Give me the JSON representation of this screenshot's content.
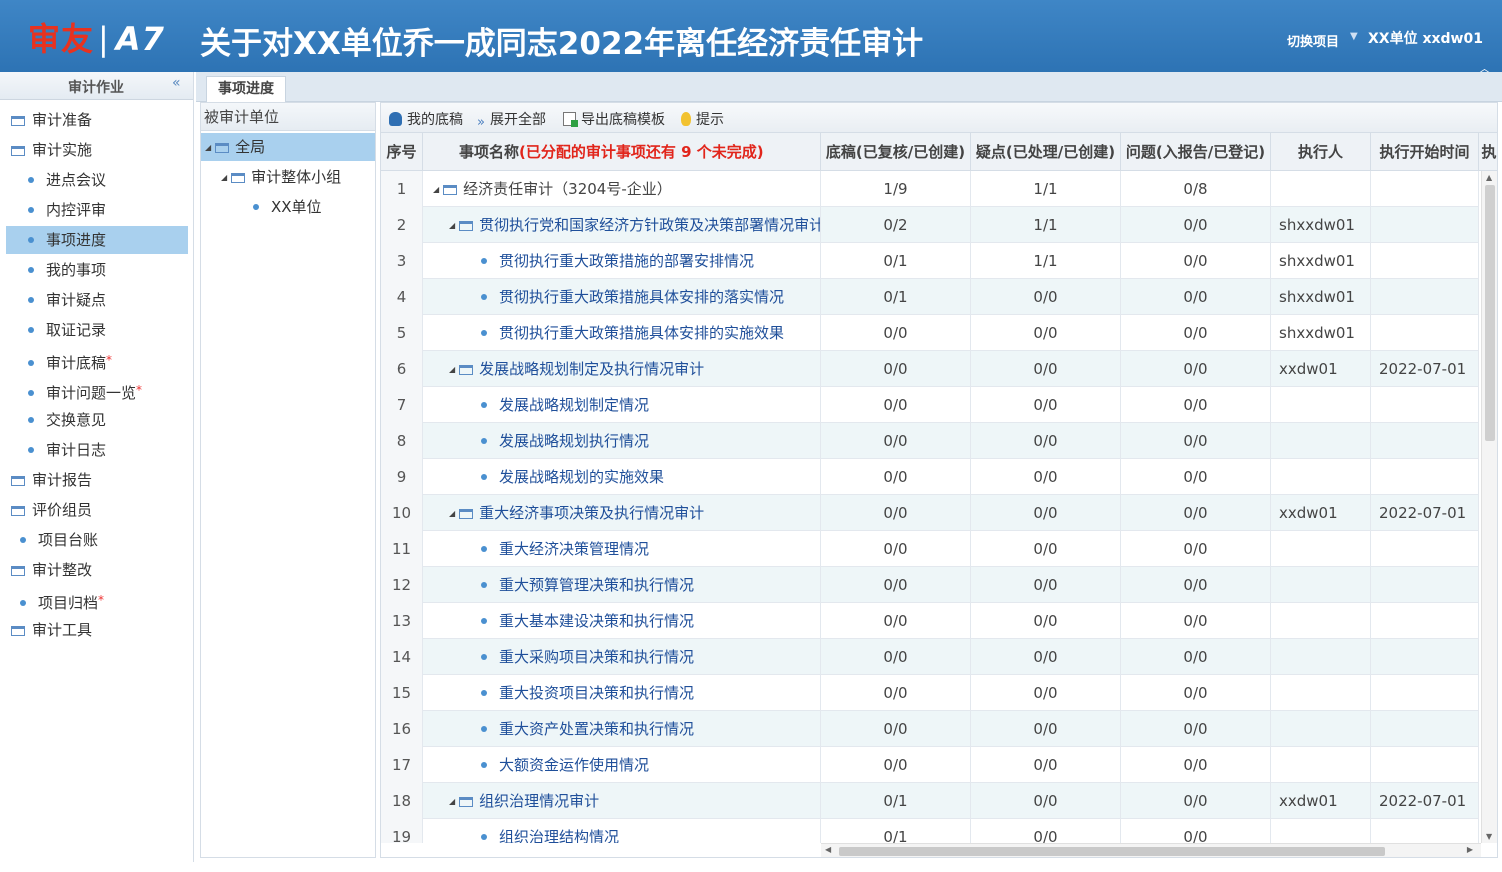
{
  "header": {
    "logo_brand": "审友",
    "logo_sep": "|",
    "logo_product": "A7",
    "title": "关于对XX单位乔一成同志2022年离任经济责任审计",
    "switch_project": "切换项目",
    "user": "XX单位  xxdw01"
  },
  "leftnav": {
    "title": "审计作业",
    "items": [
      {
        "label": "审计准备",
        "kind": "folder"
      },
      {
        "label": "审计实施",
        "kind": "folder"
      },
      {
        "label": "进点会议",
        "kind": "child"
      },
      {
        "label": "内控评审",
        "kind": "child"
      },
      {
        "label": "事项进度",
        "kind": "child",
        "selected": true
      },
      {
        "label": "我的事项",
        "kind": "child"
      },
      {
        "label": "审计疑点",
        "kind": "child"
      },
      {
        "label": "取证记录",
        "kind": "child"
      },
      {
        "label": "审计底稿",
        "kind": "child",
        "star": "*"
      },
      {
        "label": "审计问题一览",
        "kind": "child",
        "star": "*"
      },
      {
        "label": "交换意见",
        "kind": "child"
      },
      {
        "label": "审计日志",
        "kind": "child"
      },
      {
        "label": "审计报告",
        "kind": "folder"
      },
      {
        "label": "评价组员",
        "kind": "folder"
      },
      {
        "label": "项目台账",
        "kind": "child2"
      },
      {
        "label": "审计整改",
        "kind": "folder"
      },
      {
        "label": "项目归档",
        "kind": "child2",
        "star": "*"
      },
      {
        "label": "审计工具",
        "kind": "folder"
      }
    ]
  },
  "tabs": [
    {
      "label": "事项进度"
    }
  ],
  "unit_tree": {
    "header": "被审计单位",
    "nodes": [
      {
        "label": "全局"
      },
      {
        "label": "审计整体小组"
      },
      {
        "label": "XX单位"
      }
    ]
  },
  "toolbar": {
    "my_drafts": "我的底稿",
    "expand_all": "展开全部",
    "export_template": "导出底稿模板",
    "hint": "提示"
  },
  "grid": {
    "columns": {
      "no": "序号",
      "name_prefix": "事项名称",
      "name_alert": "(已分配的审计事项还有 9 个未完成)",
      "drafts": "底稿(已复核/已创建)",
      "doubts": "疑点(已处理/已创建)",
      "issues": "问题(入报告/已登记)",
      "executor": "执行人",
      "start_time": "执行开始时间",
      "extra": "执"
    },
    "rows": [
      {
        "no": "1",
        "level": 0,
        "name": "经济责任审计（3204号-企业）",
        "d": "1/9",
        "q": "1/1",
        "w": "0/8",
        "exec": "",
        "start": ""
      },
      {
        "no": "2",
        "level": 1,
        "name": "贯彻执行党和国家经济方针政策及决策部署情况审计",
        "d": "0/2",
        "q": "1/1",
        "w": "0/0",
        "exec": "shxxdw01",
        "start": ""
      },
      {
        "no": "3",
        "level": 2,
        "name": "贯彻执行重大政策措施的部署安排情况",
        "d": "0/1",
        "q": "1/1",
        "w": "0/0",
        "exec": "shxxdw01",
        "start": ""
      },
      {
        "no": "4",
        "level": 2,
        "name": "贯彻执行重大政策措施具体安排的落实情况",
        "d": "0/1",
        "q": "0/0",
        "w": "0/0",
        "exec": "shxxdw01",
        "start": ""
      },
      {
        "no": "5",
        "level": 2,
        "name": "贯彻执行重大政策措施具体安排的实施效果",
        "d": "0/0",
        "q": "0/0",
        "w": "0/0",
        "exec": "shxxdw01",
        "start": ""
      },
      {
        "no": "6",
        "level": 1,
        "name": "发展战略规划制定及执行情况审计",
        "d": "0/0",
        "q": "0/0",
        "w": "0/0",
        "exec": "xxdw01",
        "start": "2022-07-01"
      },
      {
        "no": "7",
        "level": 2,
        "name": "发展战略规划制定情况",
        "d": "0/0",
        "q": "0/0",
        "w": "0/0",
        "exec": "",
        "start": ""
      },
      {
        "no": "8",
        "level": 2,
        "name": "发展战略规划执行情况",
        "d": "0/0",
        "q": "0/0",
        "w": "0/0",
        "exec": "",
        "start": ""
      },
      {
        "no": "9",
        "level": 2,
        "name": "发展战略规划的实施效果",
        "d": "0/0",
        "q": "0/0",
        "w": "0/0",
        "exec": "",
        "start": ""
      },
      {
        "no": "10",
        "level": 1,
        "name": "重大经济事项决策及执行情况审计",
        "d": "0/0",
        "q": "0/0",
        "w": "0/0",
        "exec": "xxdw01",
        "start": "2022-07-01"
      },
      {
        "no": "11",
        "level": 2,
        "name": "重大经济决策管理情况",
        "d": "0/0",
        "q": "0/0",
        "w": "0/0",
        "exec": "",
        "start": ""
      },
      {
        "no": "12",
        "level": 2,
        "name": "重大预算管理决策和执行情况",
        "d": "0/0",
        "q": "0/0",
        "w": "0/0",
        "exec": "",
        "start": ""
      },
      {
        "no": "13",
        "level": 2,
        "name": "重大基本建设决策和执行情况",
        "d": "0/0",
        "q": "0/0",
        "w": "0/0",
        "exec": "",
        "start": ""
      },
      {
        "no": "14",
        "level": 2,
        "name": "重大采购项目决策和执行情况",
        "d": "0/0",
        "q": "0/0",
        "w": "0/0",
        "exec": "",
        "start": ""
      },
      {
        "no": "15",
        "level": 2,
        "name": "重大投资项目决策和执行情况",
        "d": "0/0",
        "q": "0/0",
        "w": "0/0",
        "exec": "",
        "start": ""
      },
      {
        "no": "16",
        "level": 2,
        "name": "重大资产处置决策和执行情况",
        "d": "0/0",
        "q": "0/0",
        "w": "0/0",
        "exec": "",
        "start": ""
      },
      {
        "no": "17",
        "level": 2,
        "name": "大额资金运作使用情况",
        "d": "0/0",
        "q": "0/0",
        "w": "0/0",
        "exec": "",
        "start": ""
      },
      {
        "no": "18",
        "level": 1,
        "name": "组织治理情况审计",
        "d": "0/1",
        "q": "0/0",
        "w": "0/0",
        "exec": "xxdw01",
        "start": "2022-07-01"
      },
      {
        "no": "19",
        "level": 2,
        "name": "组织治理结构情况",
        "d": "0/1",
        "q": "0/0",
        "w": "0/0",
        "exec": "",
        "start": ""
      }
    ]
  }
}
